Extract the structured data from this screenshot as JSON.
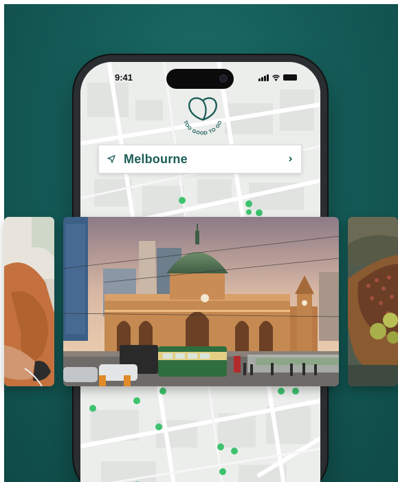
{
  "status_bar": {
    "time": "9:41"
  },
  "brand": {
    "name": "TOO GOOD TO GO"
  },
  "location": {
    "city": "Melbourne"
  },
  "cards": {
    "left": {
      "subject": "person-photo"
    },
    "main": {
      "subject": "flinders-street-station-photo"
    },
    "right": {
      "subject": "food-bowl-photo"
    }
  },
  "colors": {
    "background": "#155d59",
    "brand_green": "#1a5c56",
    "map_dot": "#3ec26e",
    "map_base": "#eceeec"
  },
  "icons": [
    "location-arrow-icon",
    "chevron-right-icon",
    "signal-icon",
    "wifi-icon",
    "battery-icon"
  ]
}
